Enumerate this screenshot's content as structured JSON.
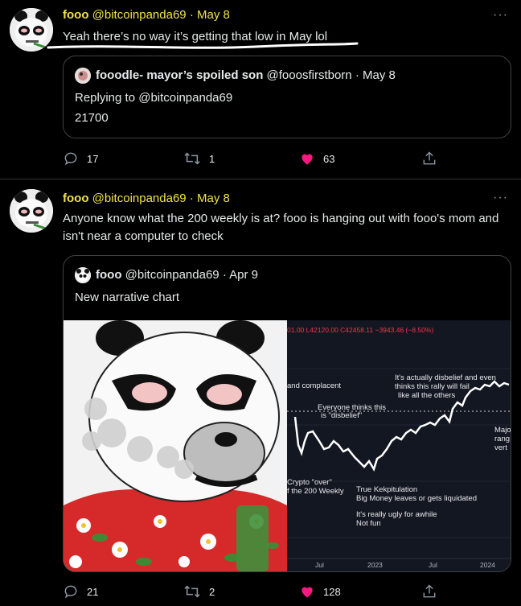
{
  "tweets": [
    {
      "name": "fooo",
      "handle": "@bitcoinpanda69",
      "sep": "·",
      "date": "May 8",
      "more": "···",
      "text": "Yeah there’s no way it’s getting that low in May lol",
      "quote": {
        "name": "fooodle- mayor’s spoiled son",
        "handle": "@fooosfirstborn",
        "sep": "·",
        "date": "May 8",
        "replying_to": "Replying to @bitcoinpanda69",
        "text": "21700"
      },
      "actions": {
        "replies": "17",
        "retweets": "1",
        "likes": "63"
      }
    },
    {
      "name": "fooo",
      "handle": "@bitcoinpanda69",
      "sep": "·",
      "date": "May 8",
      "more": "···",
      "text": "Anyone know what the 200 weekly is at? fooo is hanging out with fooo's mom and isn't near a computer to check",
      "quote": {
        "name": "fooo",
        "handle": "@bitcoinpanda69",
        "sep": "·",
        "date": "Apr 9",
        "text": "New narrative chart",
        "chart": {
          "ohlc_text": "01.00 L42120.00 C42458.11 −3943.46 (−8.50%)",
          "annotations": [
            "and complacent",
            "It's actually disbelief and even",
            "thinks this rally will fail",
            "like all the others",
            "Everyone thinks this",
            "is \"disbelief\"",
            "Crypto \"over\"",
            "f the 200 Weekly",
            "True Kekpitulation",
            "Big Money leaves or gets liquidated",
            "It's really ugly for awhile",
            "Not fun",
            "Majo",
            "rang",
            "vert"
          ],
          "x_ticks": [
            "Jul",
            "2023",
            "Jul",
            "2024"
          ]
        }
      },
      "actions": {
        "replies": "21",
        "retweets": "2",
        "likes": "128"
      }
    }
  ],
  "colors": {
    "accent": "#f0e34a",
    "like": "#f91880",
    "muted": "#8b98a5",
    "border": "#3e4144"
  }
}
